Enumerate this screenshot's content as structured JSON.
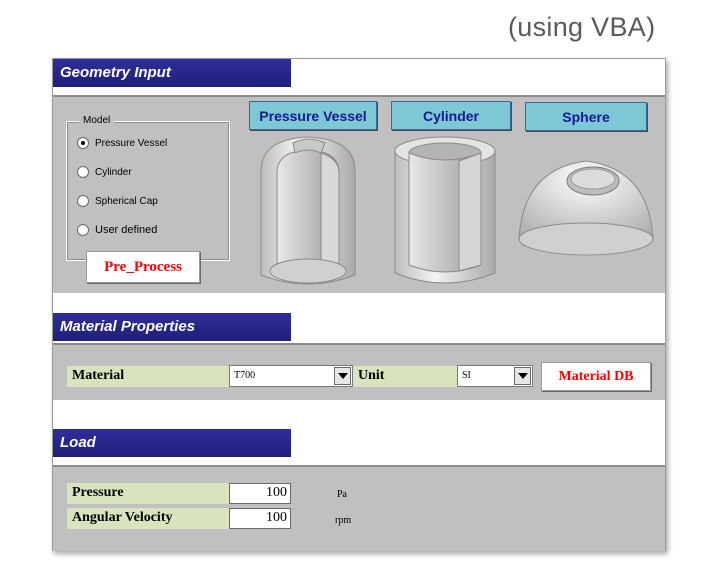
{
  "caption": "(using VBA)",
  "geometry": {
    "header": "Geometry Input",
    "model_legend": "Model",
    "options": [
      {
        "label": "Pressure Vessel",
        "checked": true
      },
      {
        "label": "Cylinder",
        "checked": false
      },
      {
        "label": "Spherical Cap",
        "checked": false
      },
      {
        "label": "User defined",
        "checked": false
      }
    ],
    "pre_process": "Pre_Process",
    "shape_buttons": [
      "Pressure Vessel",
      "Cylinder",
      "Sphere"
    ]
  },
  "material": {
    "header": "Material Properties",
    "material_label": "Material",
    "material_value": "T700",
    "unit_label": "Unit",
    "unit_value": "SI",
    "db_button": "Material DB"
  },
  "load": {
    "header": "Load",
    "pressure_label": "Pressure",
    "pressure_value": "100",
    "pressure_unit": "Pa",
    "velocity_label": "Angular Velocity",
    "velocity_value": "100",
    "velocity_unit": "rpm"
  },
  "colors": {
    "header_bg": "#1f1f7a",
    "panel_bg": "#c0c0c0",
    "label_bg": "#d7e4bd",
    "button_cyan": "#7dc7d7",
    "button_red_text": "#ff0000"
  }
}
